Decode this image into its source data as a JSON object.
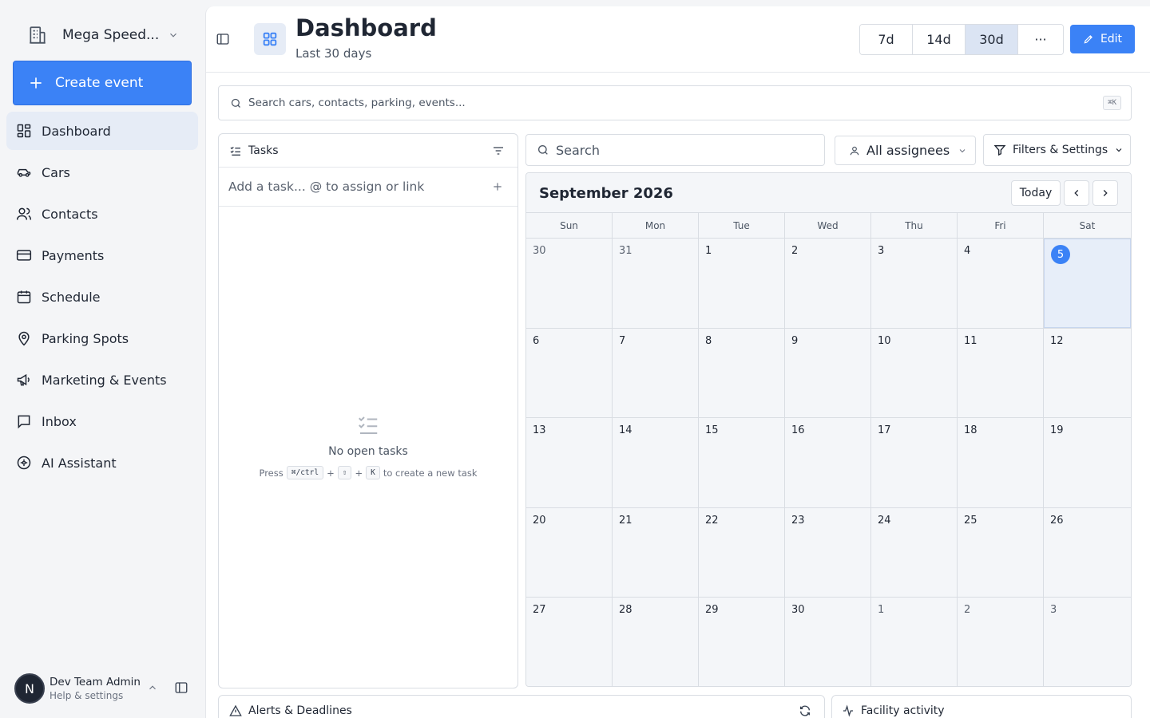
{
  "sidebar": {
    "org_name": "Mega Speed...",
    "create_label": "Create event",
    "items": [
      {
        "label": "Dashboard",
        "icon": "dashboard-icon",
        "active": true
      },
      {
        "label": "Cars",
        "icon": "car-icon"
      },
      {
        "label": "Contacts",
        "icon": "contacts-icon"
      },
      {
        "label": "Payments",
        "icon": "credit-card-icon"
      },
      {
        "label": "Schedule",
        "icon": "calendar-icon"
      },
      {
        "label": "Parking Spots",
        "icon": "map-pin-icon"
      },
      {
        "label": "Marketing & Events",
        "icon": "megaphone-icon"
      },
      {
        "label": "Inbox",
        "icon": "inbox-icon"
      },
      {
        "label": "AI Assistant",
        "icon": "ai-icon"
      }
    ],
    "user": {
      "initial": "N",
      "name": "Dev Team Admin",
      "sub": "Help & settings"
    }
  },
  "header": {
    "title": "Dashboard",
    "subtitle": "Last 30 days",
    "ranges": [
      "7d",
      "14d",
      "30d"
    ],
    "selected_range": "30d",
    "more_label": "···",
    "edit_label": "Edit"
  },
  "search": {
    "placeholder": "Search cars, contacts, parking, events...",
    "shortcut": "⌘K"
  },
  "tasks": {
    "title": "Tasks",
    "add_placeholder": "Add a task... @ to assign or link",
    "empty_title": "No open tasks",
    "hint_press": "Press",
    "hint_keys": [
      "⌘/ctrl",
      "⇧",
      "K"
    ],
    "hint_plus": "+",
    "hint_tail": "to create a new task"
  },
  "calendar_toolbar": {
    "search_placeholder": "Search",
    "assignees_label": "All assignees",
    "filters_label": "Filters & Settings"
  },
  "calendar": {
    "month_title": "September 2026",
    "today_label": "Today",
    "weekdays": [
      "Sun",
      "Mon",
      "Tue",
      "Wed",
      "Thu",
      "Fri",
      "Sat"
    ],
    "weeks": [
      [
        {
          "d": "30",
          "other": true
        },
        {
          "d": "31",
          "other": true
        },
        {
          "d": "1"
        },
        {
          "d": "2"
        },
        {
          "d": "3"
        },
        {
          "d": "4"
        },
        {
          "d": "5",
          "today": true
        }
      ],
      [
        {
          "d": "6"
        },
        {
          "d": "7"
        },
        {
          "d": "8"
        },
        {
          "d": "9"
        },
        {
          "d": "10"
        },
        {
          "d": "11"
        },
        {
          "d": "12"
        }
      ],
      [
        {
          "d": "13"
        },
        {
          "d": "14"
        },
        {
          "d": "15"
        },
        {
          "d": "16"
        },
        {
          "d": "17"
        },
        {
          "d": "18"
        },
        {
          "d": "19"
        }
      ],
      [
        {
          "d": "20"
        },
        {
          "d": "21"
        },
        {
          "d": "22"
        },
        {
          "d": "23"
        },
        {
          "d": "24"
        },
        {
          "d": "25"
        },
        {
          "d": "26"
        }
      ],
      [
        {
          "d": "27"
        },
        {
          "d": "28"
        },
        {
          "d": "29"
        },
        {
          "d": "30"
        },
        {
          "d": "1",
          "other": true
        },
        {
          "d": "2",
          "other": true
        },
        {
          "d": "3",
          "other": true
        }
      ]
    ]
  },
  "cards": {
    "alerts_title": "Alerts & Deadlines",
    "facility_title": "Facility activity"
  },
  "colors": {
    "accent": "#3b82f6",
    "active_nav_bg": "#e6ecf6",
    "selected_range_bg": "#dbe4f3"
  }
}
